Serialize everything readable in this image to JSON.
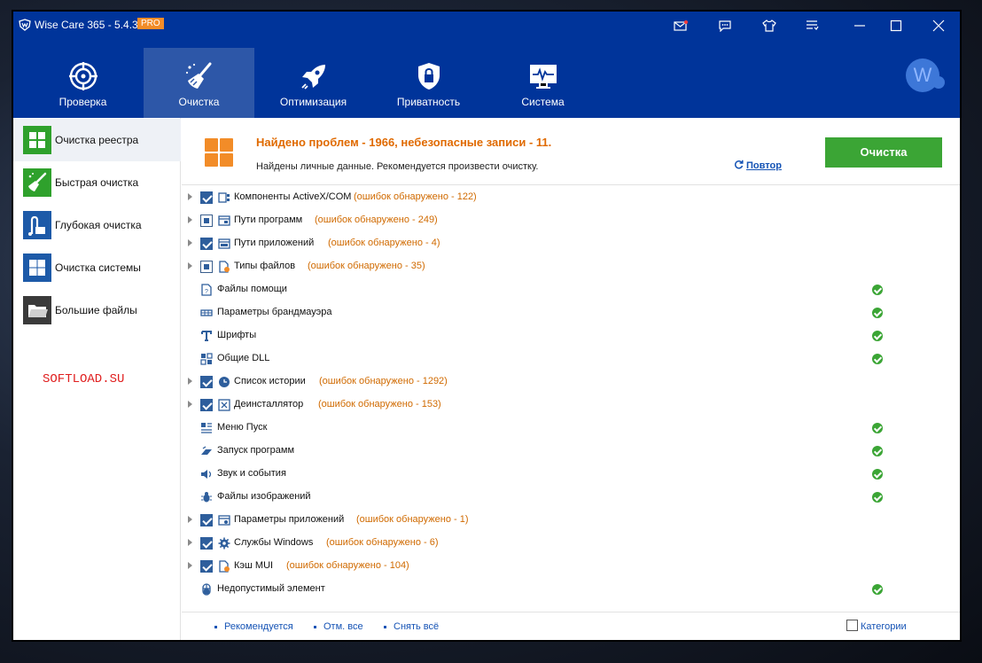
{
  "app": {
    "title": "Wise Care 365 - 5.4.3",
    "badge": "PRO"
  },
  "titlebar_icons": [
    "mail-icon",
    "chat-icon",
    "shirt-icon",
    "menu-icon",
    "minimize-icon",
    "maximize-icon",
    "close-icon"
  ],
  "nav": {
    "tabs": [
      {
        "label": "Проверка",
        "icon": "target-icon"
      },
      {
        "label": "Очистка",
        "icon": "broom-icon",
        "active": true
      },
      {
        "label": "Оптимизация",
        "icon": "rocket-icon"
      },
      {
        "label": "Приватность",
        "icon": "lock-shield-icon"
      },
      {
        "label": "Система",
        "icon": "monitor-icon"
      }
    ],
    "avatar_letter": "W"
  },
  "sidebar": {
    "items": [
      {
        "label": "Очистка реестра",
        "icon": "grid-icon",
        "color": "#2fa12c",
        "active": true
      },
      {
        "label": "Быстрая очистка",
        "icon": "brush-icon",
        "color": "#2fa12c"
      },
      {
        "label": "Глубокая очистка",
        "icon": "vacuum-icon",
        "color": "#1d5aa8"
      },
      {
        "label": "Очистка системы",
        "icon": "windows-icon",
        "color": "#1d5aa8"
      },
      {
        "label": "Большие файлы",
        "icon": "folder-icon",
        "color": "#3a3a3a"
      }
    ],
    "watermark": "SOFTLOAD.SU"
  },
  "header": {
    "title": "Найдено проблем - 1966, небезопасные записи - 11.",
    "subtitle": "Найдены личные данные. Рекомендуется произвести очистку.",
    "repeat_label": "Повтор",
    "clean_label": "Очистка"
  },
  "items": [
    {
      "label": "Компоненты ActiveX/COM",
      "errors": "(ошибок обнаружено - 122)",
      "expandable": true,
      "check": "checked"
    },
    {
      "label": "Пути программ",
      "errors": "(ошибок обнаружено - 249)",
      "expandable": true,
      "check": "partial"
    },
    {
      "label": "Пути приложений",
      "errors": "(ошибок обнаружено - 4)",
      "expandable": true,
      "check": "checked"
    },
    {
      "label": "Типы файлов",
      "errors": "(ошибок обнаружено - 35)",
      "expandable": true,
      "check": "partial"
    },
    {
      "label": "Файлы помощи",
      "ok": true
    },
    {
      "label": "Параметры брандмауэра",
      "ok": true
    },
    {
      "label": "Шрифты",
      "ok": true
    },
    {
      "label": "Общие DLL",
      "ok": true
    },
    {
      "label": "Список истории",
      "errors": "(ошибок обнаружено - 1292)",
      "expandable": true,
      "check": "checked"
    },
    {
      "label": "Деинсталлятор",
      "errors": "(ошибок обнаружено - 153)",
      "expandable": true,
      "check": "checked"
    },
    {
      "label": "Меню Пуск",
      "ok": true
    },
    {
      "label": "Запуск программ",
      "ok": true
    },
    {
      "label": "Звук и события",
      "ok": true
    },
    {
      "label": "Файлы изображений",
      "ok": true
    },
    {
      "label": "Параметры приложений",
      "errors": "(ошибок обнаружено - 1)",
      "expandable": true,
      "check": "checked"
    },
    {
      "label": "Службы Windows",
      "errors": "(ошибок обнаружено - 6)",
      "expandable": true,
      "check": "checked"
    },
    {
      "label": "Кэш MUI",
      "errors": "(ошибок обнаружено - 104)",
      "expandable": true,
      "check": "checked"
    },
    {
      "label": "Недопустимый элемент",
      "ok": true
    }
  ],
  "footer": {
    "recommended": "Рекомендуется",
    "select_all": "Отм. все",
    "deselect_all": "Снять всё",
    "categories": "Категории"
  },
  "colors": {
    "brand": "#00349a",
    "active_tab": "#2d57a8",
    "clean_button": "#3ba535",
    "error_text": "#d06a00",
    "link": "#1553b5"
  }
}
